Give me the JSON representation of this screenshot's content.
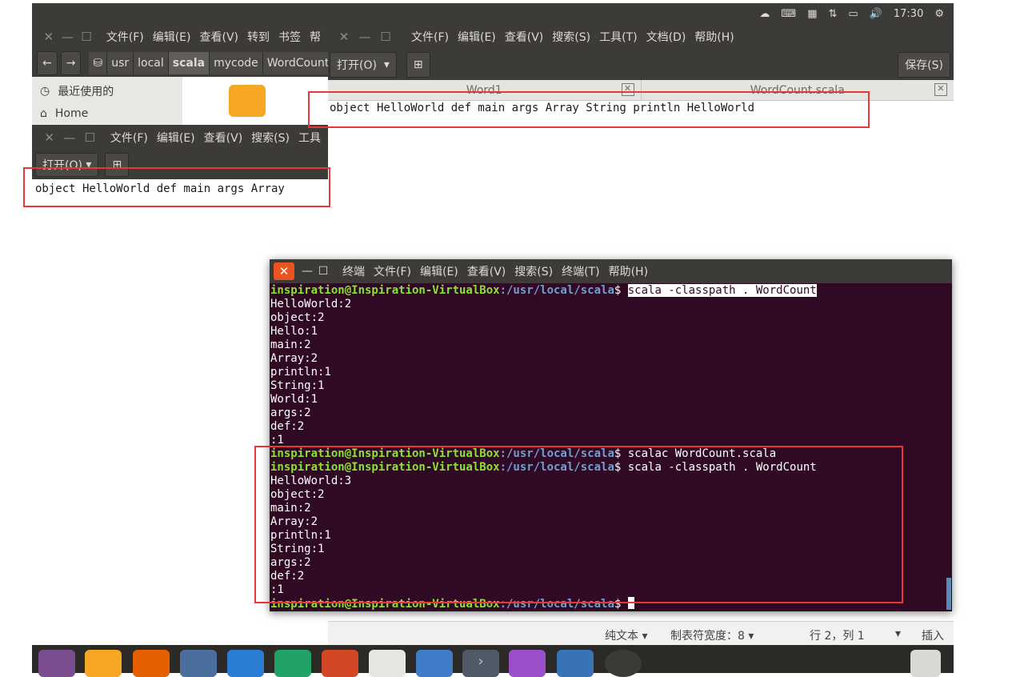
{
  "topbar": {
    "time": "17:30",
    "icons": [
      "weather-icon",
      "keyboard-icon",
      "calendar-icon",
      "network-icon",
      "battery-icon",
      "volume-icon",
      "settings-gear-icon"
    ]
  },
  "files_window": {
    "menu": [
      "文件(F)",
      "编辑(E)",
      "查看(V)",
      "转到",
      "书签",
      "帮"
    ],
    "breadcrumbs": [
      "usr",
      "local",
      "scala",
      "mycode",
      "WordCount"
    ],
    "sidebar": [
      {
        "label": "最近使用的",
        "icon": "clock-icon"
      },
      {
        "label": "Home",
        "icon": "home-icon"
      }
    ]
  },
  "editor_back": {
    "menu": [
      "文件(F)",
      "编辑(E)",
      "查看(V)",
      "搜索(S)",
      "工具"
    ],
    "open_label": "打开(O)",
    "text": "object HelloWorld def main args Array"
  },
  "editor_main": {
    "menu": [
      "文件(F)",
      "编辑(E)",
      "查看(V)",
      "搜索(S)",
      "工具(T)",
      "文档(D)",
      "帮助(H)"
    ],
    "open_label": "打开(O)",
    "save_label": "保存(S)",
    "tabs": [
      "Word1",
      "WordCount.scala"
    ],
    "text": "object HelloWorld def main args Array String println HelloWorld",
    "status": {
      "lang": "纯文本",
      "tab_width": "制表符宽度：8",
      "position": "行 2，列 1",
      "mode": "插入"
    }
  },
  "terminal": {
    "menu": [
      "终端",
      "文件(F)",
      "编辑(E)",
      "查看(V)",
      "搜索(S)",
      "终端(T)",
      "帮助(H)"
    ],
    "prompt_user": "inspiration@Inspiration-VirtualBox",
    "prompt_path": ":/usr/local/scala",
    "prompt_sign": "$ ",
    "cmd1": "scala -classpath . WordCount",
    "out1": [
      "HelloWorld:2",
      "object:2",
      "Hello:1",
      "main:2",
      "Array:2",
      "println:1",
      "String:1",
      "World:1",
      "args:2",
      "def:2",
      ":1"
    ],
    "cmd2": "scalac WordCount.scala",
    "cmd3": "scala -classpath . WordCount",
    "out2": [
      "HelloWorld:3",
      "object:2",
      "main:2",
      "Array:2",
      "println:1",
      "String:1",
      "args:2",
      "def:2",
      ":1"
    ]
  },
  "dock": [
    "ubuntu-logo-icon",
    "files-icon",
    "firefox-icon",
    "search-icon",
    "word-icon",
    "excel-icon",
    "powerpoint-icon",
    "software-center-icon",
    "browser-icon",
    "terminal-icon",
    "editor-icon",
    "workspaces-icon",
    "dvd-icon",
    "trash-icon"
  ],
  "colors": {
    "terminal_bg": "#300a24",
    "prompt_user": "#8ae234",
    "prompt_path": "#729fcf",
    "highlight": "#e53935",
    "close_button": "#e95420"
  }
}
